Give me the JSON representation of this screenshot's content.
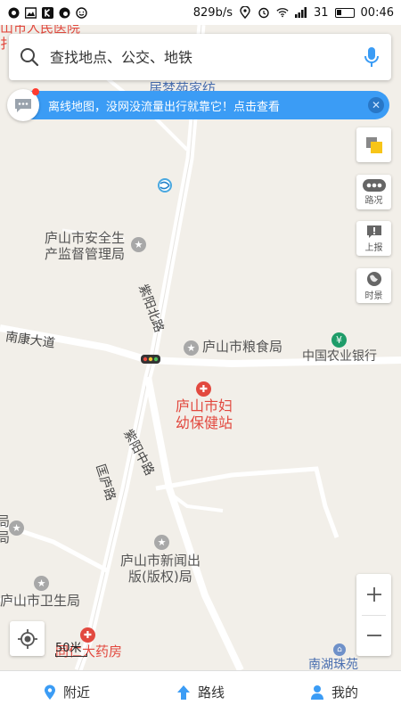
{
  "status_bar": {
    "net_speed": "829b/s",
    "signal_value": "31",
    "time": "00:46",
    "left_icons": [
      "app-icon",
      "gallery-icon",
      "k-app-icon",
      "camera-app-icon",
      "smiley-app-icon"
    ]
  },
  "search": {
    "placeholder": "查找地点、公交、地铁"
  },
  "banner": {
    "text": "离线地图，没网没流量出行就靠它！点击查看"
  },
  "map": {
    "partial_labels": [
      "山市人民医院",
      "扌",
      "居梦苑家纺"
    ],
    "pois": [
      {
        "name_line1": "庐山市安全生",
        "name_line2": "产监督管理局"
      },
      {
        "name": "庐山市粮食局"
      },
      {
        "name": "中国农业银行"
      },
      {
        "name_line1": "庐山市妇",
        "name_line2": "幼保健站"
      },
      {
        "name_line1": "庐山市新闻出",
        "name_line2": "版(版权)局"
      },
      {
        "name": "庐山市卫生局"
      },
      {
        "name": "同仁大药房"
      },
      {
        "name": "南湖珠苑"
      }
    ],
    "roads": {
      "ziyang_north": "紫阳北路",
      "nankang": "南康大道",
      "ziyang_middle": "紫阳中路",
      "kuanglu": "匡庐路"
    },
    "left_edge_labels": [
      "局",
      "局"
    ]
  },
  "tools": {
    "traffic": "路况",
    "report": "上报",
    "timescape": "时景"
  },
  "scale": {
    "label": "50米"
  },
  "bottom_nav": {
    "nearby": "附近",
    "route": "路线",
    "mine": "我的"
  },
  "colors": {
    "accent": "#3b9cf5",
    "poi_red": "#e2493f",
    "bank_green": "#1f9c69",
    "notification_red": "#ff3b30",
    "map_bg": "#f2efe9"
  }
}
